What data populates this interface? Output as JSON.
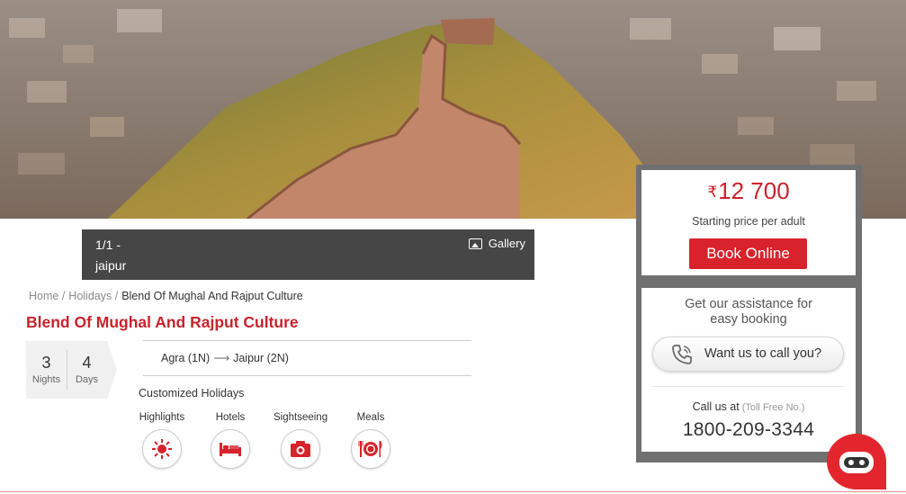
{
  "hero": {
    "image": "Jaipur fort wall on a hill above the city",
    "colors": {
      "sky": "#a09080",
      "city": "#8c7d72",
      "wall": "#c2876a",
      "hill": "#7d8a3a"
    }
  },
  "gallery_caption": {
    "counter": "1/1  -",
    "place": "jaipur",
    "gallery_label": "Gallery",
    "gallery_icon": "image-icon"
  },
  "breadcrumb": {
    "home": "Home /",
    "holidays": "Holidays /",
    "current": "Blend Of Mughal And Rajput Culture"
  },
  "package": {
    "title": "Blend Of Mughal And Rajput Culture",
    "nights_value": "3",
    "nights_label": "Nights",
    "days_value": "4",
    "days_label": "Days",
    "route_from": "Agra (1N)",
    "route_arrow": "⟶",
    "route_to": "Jaipur (2N)",
    "holiday_type": "Customized Holidays"
  },
  "features": [
    {
      "label": "Highlights",
      "icon": "sun-icon"
    },
    {
      "label": "Hotels",
      "icon": "bed-icon"
    },
    {
      "label": "Sightseeing",
      "icon": "camera-icon"
    },
    {
      "label": "Meals",
      "icon": "meals-icon"
    }
  ],
  "pricing": {
    "currency_symbol": "₹",
    "amount": "12 700",
    "note": "Starting price per adult",
    "book_label": "Book Online"
  },
  "assistance": {
    "title_line1": "Get our assistance for",
    "title_line2": "easy booking",
    "call_button_label": "Want us to call you?",
    "call_at": "Call us at",
    "toll_free": "(Toll Free No.)",
    "phone_number": "1800-209-3344"
  },
  "colors": {
    "brand_red": "#d8232c",
    "title_red": "#c8232c",
    "panel_grey": "#707070",
    "caption_bg": "#464646"
  }
}
